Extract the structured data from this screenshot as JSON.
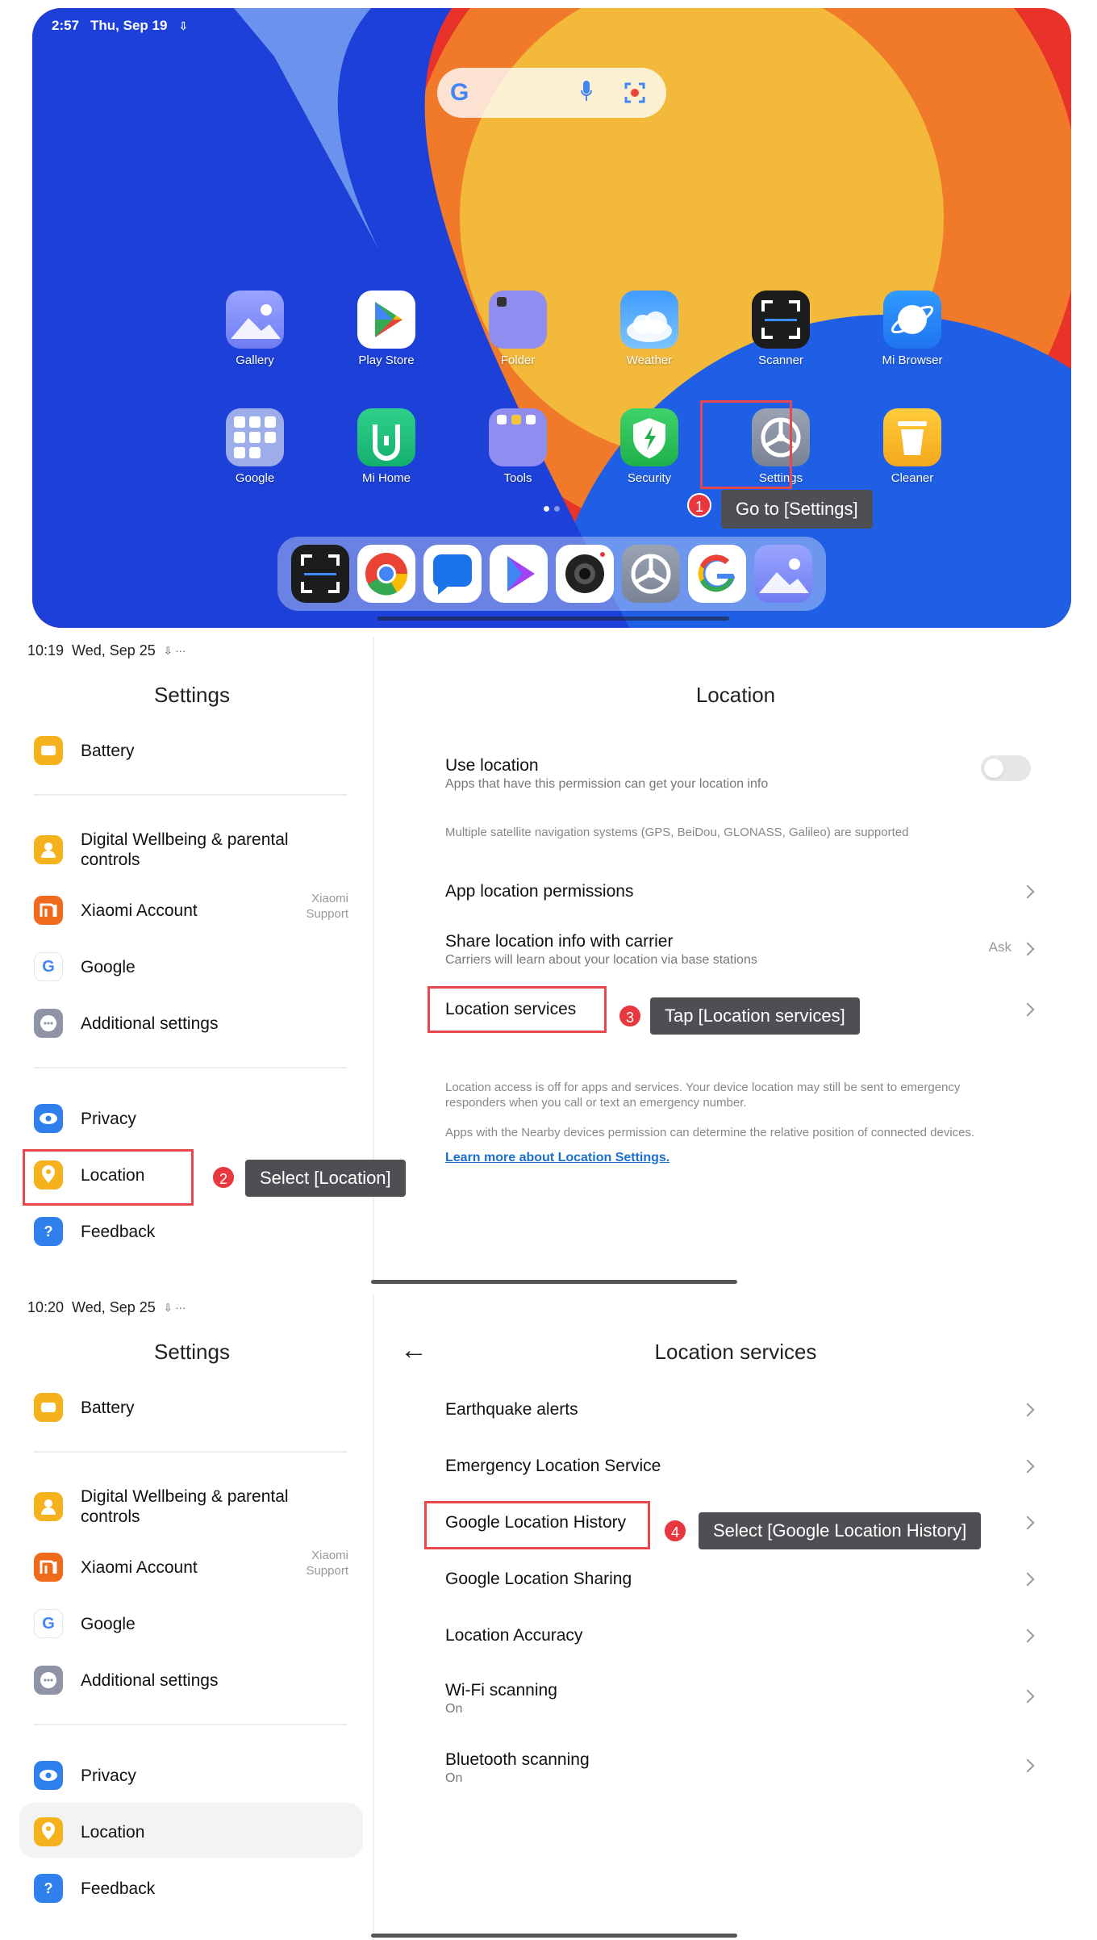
{
  "home": {
    "status": {
      "time": "2:57",
      "date": "Thu, Sep 19"
    },
    "search": {
      "logo": "G"
    },
    "apps_row1": [
      {
        "label": "Gallery",
        "icon": "gallery-icon"
      },
      {
        "label": "Play Store",
        "icon": "play-store-icon"
      },
      {
        "label": "Folder",
        "icon": "folder-icon"
      },
      {
        "label": "Weather",
        "icon": "weather-icon"
      },
      {
        "label": "Scanner",
        "icon": "scanner-icon"
      },
      {
        "label": "Mi Browser",
        "icon": "browser-icon"
      }
    ],
    "apps_row2": [
      {
        "label": "Google",
        "icon": "google-folder-icon"
      },
      {
        "label": "Mi Home",
        "icon": "mi-home-icon"
      },
      {
        "label": "Tools",
        "icon": "tools-folder-icon"
      },
      {
        "label": "Security",
        "icon": "security-icon"
      },
      {
        "label": "Settings",
        "icon": "settings-icon"
      },
      {
        "label": "Cleaner",
        "icon": "cleaner-icon"
      }
    ],
    "dock": [
      "scanner-icon",
      "chrome-icon",
      "messages-icon",
      "play-games-icon",
      "camera-icon",
      "settings-icon",
      "google-icon",
      "gallery-icon"
    ],
    "step": {
      "number": "1",
      "text": "Go to [Settings]"
    }
  },
  "settings_left": {
    "title": "Settings",
    "items": [
      {
        "label": "Battery",
        "icon": "battery-icon",
        "color": "#f5b21c"
      },
      {
        "label": "Digital Wellbeing & parental controls",
        "icon": "wellbeing-icon",
        "color": "#f5b21c"
      },
      {
        "label": "Xiaomi Account",
        "icon": "mi-account-icon",
        "color": "#f06a1c",
        "aside_1": "Xiaomi",
        "aside_2": "Support"
      },
      {
        "label": "Google",
        "icon": "google-icon",
        "color": "#ffffff"
      },
      {
        "label": "Additional settings",
        "icon": "more-icon",
        "color": "#8e94a6"
      },
      {
        "label": "Privacy",
        "icon": "eye-icon",
        "color": "#2f80ed"
      },
      {
        "label": "Location",
        "icon": "location-pin-icon",
        "color": "#f5b21c"
      },
      {
        "label": "Feedback",
        "icon": "feedback-icon",
        "color": "#2f80ed"
      }
    ]
  },
  "panel2": {
    "status": {
      "time": "10:19",
      "date": "Wed, Sep 25"
    },
    "title": "Location",
    "use_location": {
      "title": "Use location",
      "subtitle": "Apps that have this permission can get your location info"
    },
    "gnss_note": "Multiple satellite navigation systems (GPS, BeiDou, GLONASS, Galileo) are supported",
    "app_permissions": "App location permissions",
    "share_carrier": {
      "title": "Share location info with carrier",
      "subtitle": "Carriers will learn about your location via base stations",
      "value": "Ask"
    },
    "location_services": "Location services",
    "note1": "Location access is off for apps and services. Your device location may still be sent to emergency responders when you call or text an emergency number.",
    "note2": "Apps with the Nearby devices permission can determine the relative position of connected devices.",
    "learn_more": "Learn more about Location Settings.",
    "step2": {
      "number": "2",
      "text": "Select [Location]"
    },
    "step3": {
      "number": "3",
      "text": "Tap [Location services]"
    }
  },
  "panel3": {
    "status": {
      "time": "10:20",
      "date": "Wed, Sep 25"
    },
    "title": "Location services",
    "items": [
      {
        "title": "Earthquake alerts",
        "subtitle": ""
      },
      {
        "title": "Emergency Location Service",
        "subtitle": ""
      },
      {
        "title": "Google Location History",
        "subtitle": ""
      },
      {
        "title": "Google Location Sharing",
        "subtitle": ""
      },
      {
        "title": "Location Accuracy",
        "subtitle": ""
      },
      {
        "title": "Wi-Fi scanning",
        "subtitle": "On"
      },
      {
        "title": "Bluetooth scanning",
        "subtitle": "On"
      }
    ],
    "step4": {
      "number": "4",
      "text": "Select [Google Location History]"
    }
  },
  "colors": {
    "highlight": "#e8474e",
    "badge": "#e8373f",
    "callout": "#4d4f53",
    "link": "#1a6fd1"
  }
}
